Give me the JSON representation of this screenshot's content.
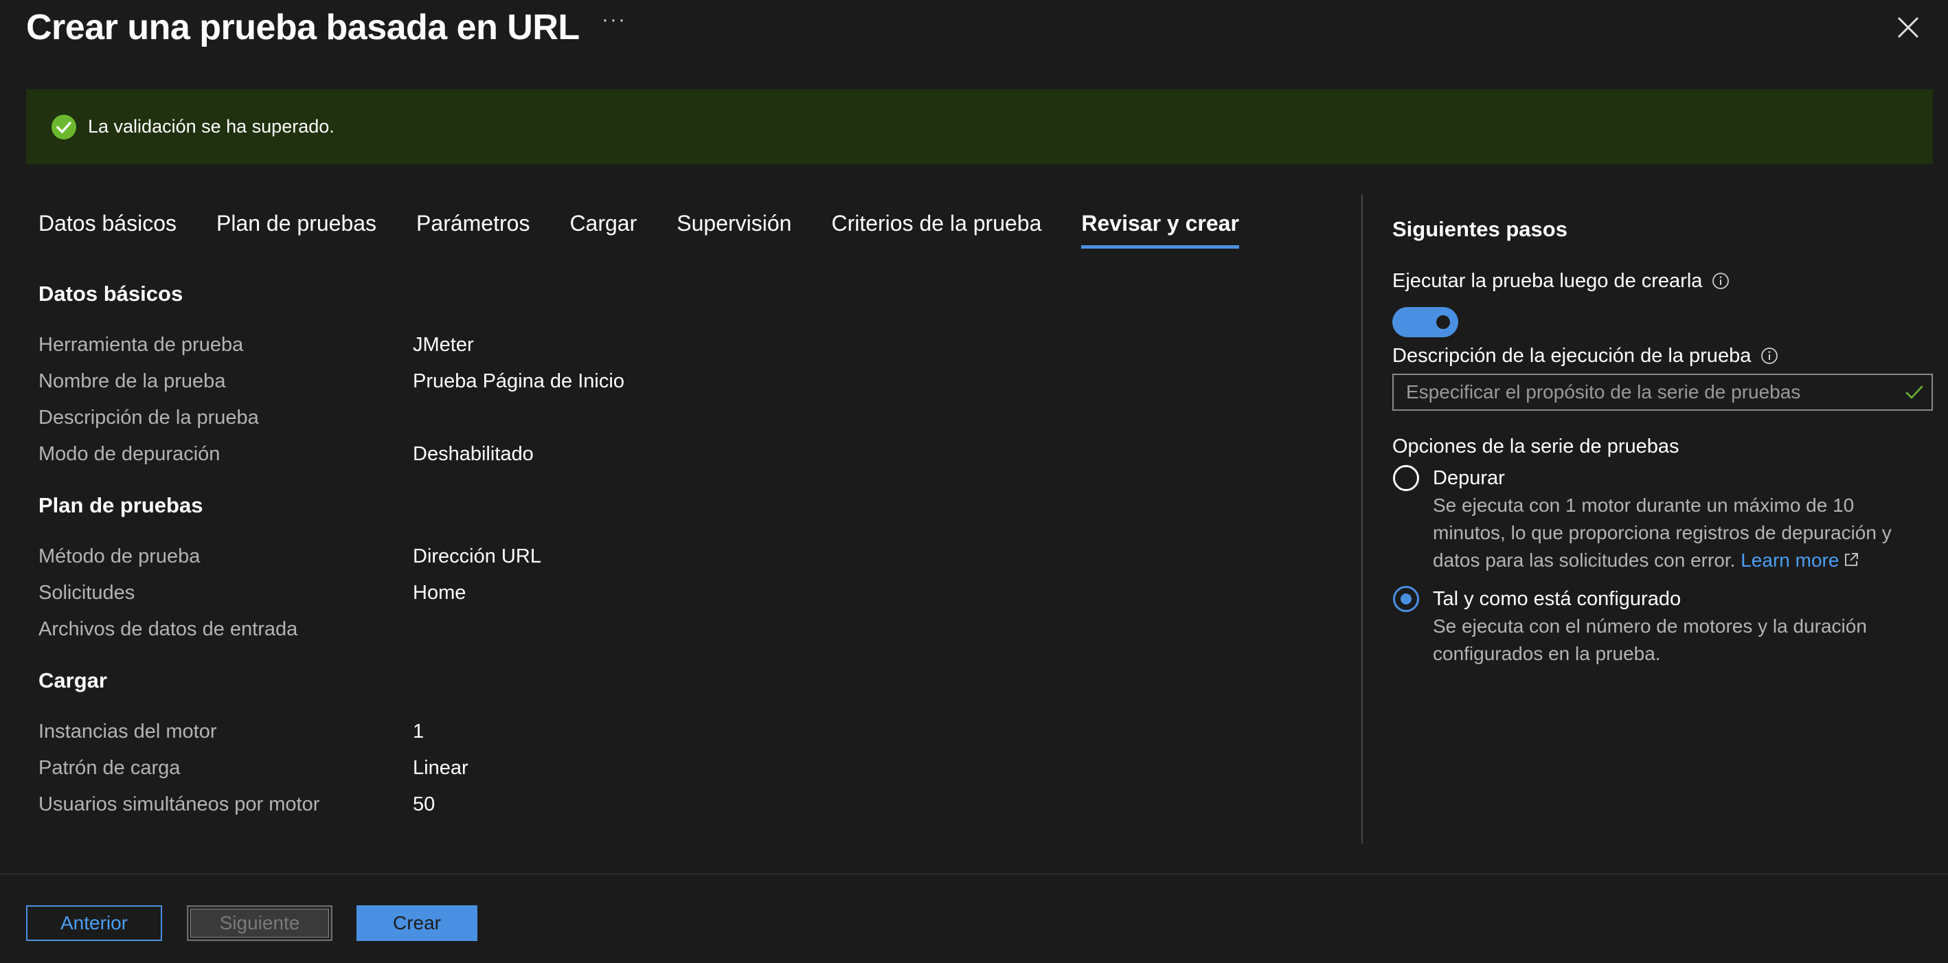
{
  "header": {
    "title": "Crear una prueba basada en URL",
    "more_label": "···"
  },
  "banner": {
    "message": "La validación se ha superado.",
    "color": "#20310f"
  },
  "tabs": [
    {
      "label": "Datos básicos",
      "active": false
    },
    {
      "label": "Plan de pruebas",
      "active": false
    },
    {
      "label": "Parámetros",
      "active": false
    },
    {
      "label": "Cargar",
      "active": false
    },
    {
      "label": "Supervisión",
      "active": false
    },
    {
      "label": "Criterios de la prueba",
      "active": false
    },
    {
      "label": "Revisar y crear",
      "active": true
    }
  ],
  "summary": {
    "basics": {
      "heading": "Datos básicos",
      "rows": [
        {
          "label": "Herramienta de prueba",
          "value": "JMeter"
        },
        {
          "label": "Nombre de la prueba",
          "value": "Prueba Página de Inicio"
        },
        {
          "label": "Descripción de la prueba",
          "value": ""
        },
        {
          "label": "Modo de depuración",
          "value": "Deshabilitado"
        }
      ]
    },
    "plan": {
      "heading": "Plan de pruebas",
      "rows": [
        {
          "label": "Método de prueba",
          "value": "Dirección URL"
        },
        {
          "label": "Solicitudes",
          "value": "Home"
        },
        {
          "label": "Archivos de datos de entrada",
          "value": ""
        }
      ]
    },
    "load": {
      "heading": "Cargar",
      "rows": [
        {
          "label": "Instancias del motor",
          "value": "1"
        },
        {
          "label": "Patrón de carga",
          "value": "Linear"
        },
        {
          "label": "Usuarios simultáneos por motor",
          "value": "50"
        }
      ]
    }
  },
  "next_steps": {
    "heading": "Siguientes pasos",
    "run_after_create_label": "Ejecutar la prueba luego de crearla",
    "run_after_create_on": true,
    "description_label": "Descripción de la ejecución de la prueba",
    "description_placeholder": "Especificar el propósito de la serie de pruebas",
    "options_label": "Opciones de la serie de pruebas",
    "options": [
      {
        "title": "Depurar",
        "description": "Se ejecuta con 1 motor durante un máximo de 10 minutos, lo que proporciona registros de depuración y datos para las solicitudes con error.",
        "link": "Learn more",
        "selected": false
      },
      {
        "title": "Tal y como está configurado",
        "description": "Se ejecuta con el número de motores y la duración configurados en la prueba.",
        "selected": true
      }
    ]
  },
  "footer": {
    "prev_label": "Anterior",
    "next_label": "Siguiente",
    "create_label": "Crear"
  },
  "colors": {
    "background": "#1b1b1b",
    "accent": "#4a90e2",
    "success": "#6bb82e",
    "link": "#4a9ff5"
  }
}
